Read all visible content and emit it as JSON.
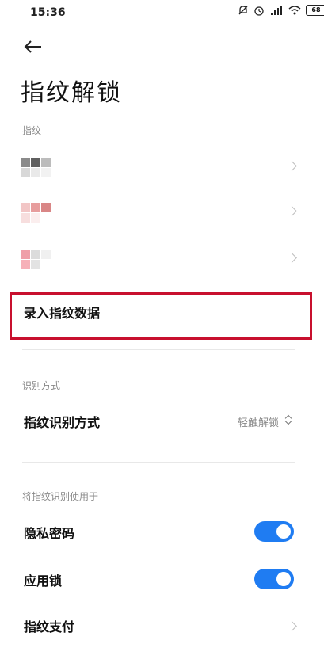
{
  "status_bar": {
    "time": "15:36",
    "battery": "68",
    "signal_label": "HD"
  },
  "header": {
    "title": "指纹解锁"
  },
  "fingerprints": {
    "section_label": "指纹",
    "items": [
      {
        "colors": [
          "#8a8a8a",
          "#5f5f5f",
          "#bcbcbc",
          "#d8d8d8",
          "#e9e9e9",
          "#f2f2f2"
        ]
      },
      {
        "colors": [
          "#f2c6c6",
          "#e79d9d",
          "#d98686",
          "#f7dede",
          "#fbeeee",
          "#ffffff"
        ]
      },
      {
        "colors": [
          "#ef9fa8",
          "#dcdcdc",
          "#f0f0f0",
          "#f6b0b8",
          "#e3e3e3",
          "#ffffff"
        ]
      }
    ],
    "add_label": "录入指纹数据"
  },
  "recognition": {
    "section_label": "识别方式",
    "method_label": "指纹识别方式",
    "method_value": "轻触解锁"
  },
  "usage": {
    "section_label": "将指纹识别使用于",
    "items": [
      {
        "label": "隐私密码",
        "control": "toggle",
        "on": true
      },
      {
        "label": "应用锁",
        "control": "toggle",
        "on": true
      },
      {
        "label": "指纹支付",
        "control": "chevron"
      }
    ]
  },
  "colors": {
    "accent": "#1f7cf2",
    "highlight": "#c8102e"
  }
}
